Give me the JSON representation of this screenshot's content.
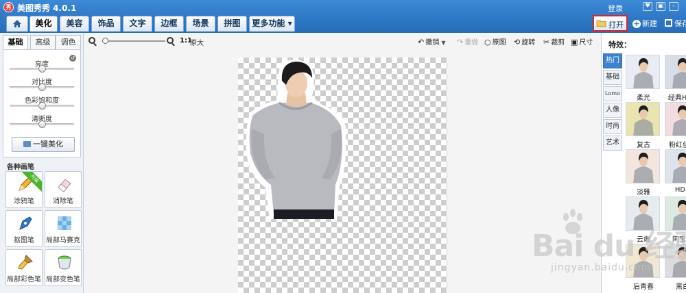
{
  "app": {
    "title": "美图秀秀 4.0.1",
    "logo_text": "秀"
  },
  "topbar": {
    "login": "登录"
  },
  "tabs": [
    "美化",
    "美容",
    "饰品",
    "文字",
    "边框",
    "场景",
    "拼图",
    "更多功能 ▾"
  ],
  "right_actions": {
    "open": "打开",
    "new": "新建",
    "save": "保存"
  },
  "left": {
    "subtabs": [
      "基础",
      "高级",
      "调色"
    ],
    "sliders": [
      {
        "label": "亮度",
        "value": 0.5
      },
      {
        "label": "对比度",
        "value": 0.5
      },
      {
        "label": "色彩饱和度",
        "value": 0.5
      },
      {
        "label": "清晰度",
        "value": 0.5
      }
    ],
    "one_click": "一键美化",
    "brush_title": "各种画笔",
    "brushes": [
      {
        "label": "涂鸦笔",
        "badge": "升级"
      },
      {
        "label": "消除笔",
        "badge": ""
      },
      {
        "label": "抠图笔",
        "badge": ""
      },
      {
        "label": "局部马赛克",
        "badge": ""
      },
      {
        "label": "局部彩色笔",
        "badge": ""
      },
      {
        "label": "局部变色笔",
        "badge": ""
      }
    ]
  },
  "toolbar": {
    "ratio": "1:1",
    "orig_size": "原大",
    "undo": "撤销",
    "redo": "重做",
    "original": "原图",
    "rotate": "旋转",
    "crop": "裁剪",
    "resize": "尺寸"
  },
  "right": {
    "title": "特效：",
    "categories": [
      "热门",
      "基础",
      "Lomo",
      "人像",
      "时尚",
      "艺术"
    ],
    "effects": [
      {
        "label": "柔光",
        "tint": "#e9ecf2"
      },
      {
        "label": "经典HDR",
        "tint": "#d9dde6"
      },
      {
        "label": "复古",
        "tint": "#eae5b0"
      },
      {
        "label": "粉红佳人",
        "tint": "#f1dde0"
      },
      {
        "label": "淡雅",
        "tint": "#f3e6df"
      },
      {
        "label": "HDR",
        "tint": "#dfe3ea"
      },
      {
        "label": "云端",
        "tint": "#e6ebee"
      },
      {
        "label": "阿宝色",
        "tint": "#dde9e3"
      },
      {
        "label": "后青春",
        "tint": "#f0e8d4"
      },
      {
        "label": "黑白",
        "tint": "#dcdcdc"
      }
    ]
  },
  "watermark": {
    "brand": "Bai du 经验",
    "url": "jingyan.baidu.com"
  }
}
